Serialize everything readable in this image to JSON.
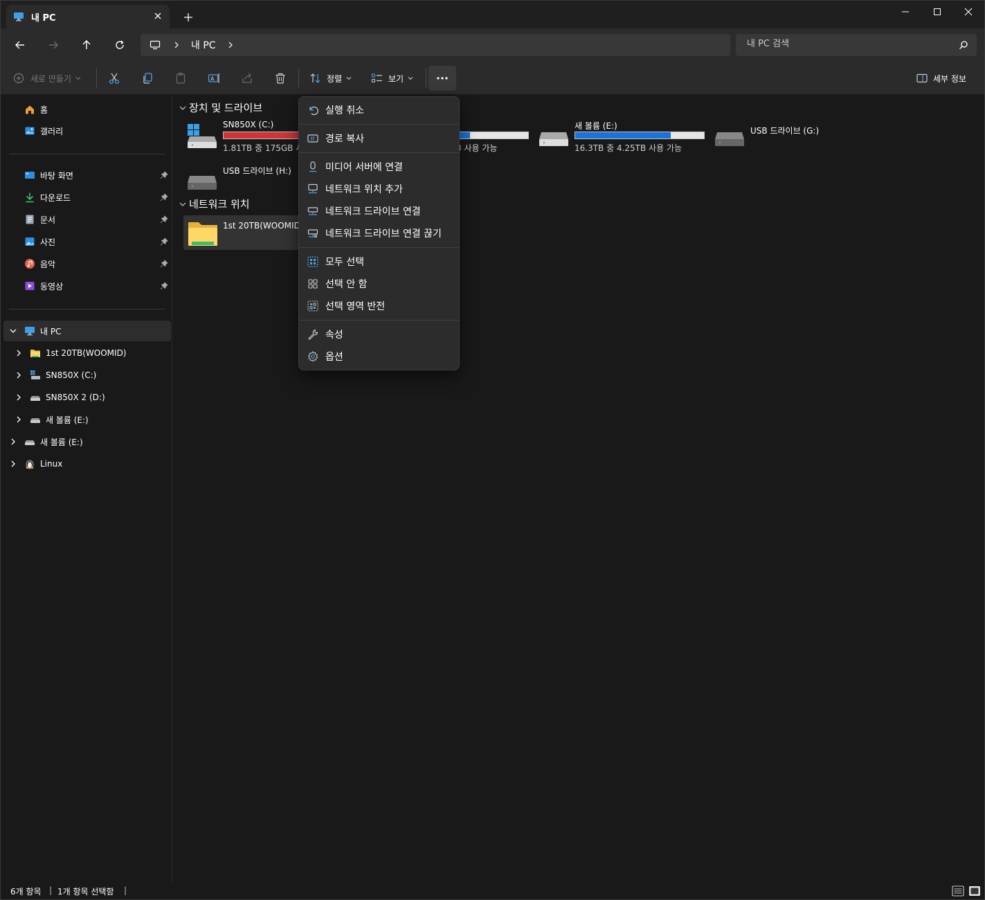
{
  "window": {
    "tab_title": "내 PC",
    "controls": [
      "minimize",
      "maximize",
      "close"
    ]
  },
  "nav": {
    "breadcrumb": [
      "내 PC"
    ],
    "search_placeholder": "내 PC 검색"
  },
  "commandbar": {
    "new_label": "새로 만들기",
    "sort_label": "정렬",
    "view_label": "보기",
    "details_label": "세부 정보"
  },
  "sidebar": {
    "quick": [
      {
        "label": "홈",
        "icon": "home-icon"
      },
      {
        "label": "갤러리",
        "icon": "gallery-icon"
      }
    ],
    "pinned": [
      {
        "label": "바탕 화면",
        "icon": "desktop-icon"
      },
      {
        "label": "다운로드",
        "icon": "download-icon"
      },
      {
        "label": "문서",
        "icon": "documents-icon"
      },
      {
        "label": "사진",
        "icon": "pictures-icon"
      },
      {
        "label": "음악",
        "icon": "music-icon"
      },
      {
        "label": "동영상",
        "icon": "videos-icon"
      }
    ],
    "tree": [
      {
        "label": "내 PC",
        "icon": "pc-icon",
        "expanded": true,
        "selected": true
      },
      {
        "label": "1st 20TB(WOOMID)",
        "icon": "network-folder-icon"
      },
      {
        "label": "SN850X (C:)",
        "icon": "windows-drive-icon"
      },
      {
        "label": "SN850X 2 (D:)",
        "icon": "drive-icon"
      },
      {
        "label": "새 볼륨 (E:)",
        "icon": "drive-icon"
      },
      {
        "label": "새 볼륨 (E:)",
        "icon": "drive-icon"
      },
      {
        "label": "Linux",
        "icon": "linux-icon"
      }
    ]
  },
  "content": {
    "devices_header": "장치 및 드라이브",
    "drives": [
      {
        "name": "SN850X (C:)",
        "free_text": "1.81TB 중 175GB 사",
        "used_fraction": 0.905,
        "bar_color": "#d13438",
        "type": "windows"
      },
      {
        "name": "",
        "free_text": "3 사용 가능",
        "used_fraction": 0.55,
        "bar_color": "#1a73d9",
        "type": "drive"
      },
      {
        "name": "새 볼륨 (E:)",
        "free_text": "16.3TB 중 4.25TB 사용 가능",
        "used_fraction": 0.74,
        "bar_color": "#1a73d9",
        "type": "drive"
      },
      {
        "name": "USB 드라이브 (G:)",
        "free_text": "",
        "used_fraction": null,
        "type": "usb"
      },
      {
        "name": "USB 드라이브 (H:)",
        "free_text": "",
        "used_fraction": null,
        "type": "usb"
      }
    ],
    "network_header": "네트워크 위치",
    "network_items": [
      {
        "name": "1st 20TB(WOOMID)"
      }
    ]
  },
  "context_menu": {
    "items": [
      {
        "label": "실행 취소",
        "icon": "undo-icon"
      },
      {
        "label": "경로 복사",
        "icon": "copy-path-icon"
      },
      {
        "label": "미디어 서버에 연결",
        "icon": "media-server-icon"
      },
      {
        "label": "네트워크 위치 추가",
        "icon": "add-network-location-icon"
      },
      {
        "label": "네트워크 드라이브 연결",
        "icon": "map-network-drive-icon"
      },
      {
        "label": "네트워크 드라이브 연결 끊기",
        "icon": "disconnect-network-drive-icon"
      },
      {
        "label": "모두 선택",
        "icon": "select-all-icon"
      },
      {
        "label": "선택 안 함",
        "icon": "select-none-icon"
      },
      {
        "label": "선택 영역 반전",
        "icon": "invert-selection-icon"
      },
      {
        "label": "속성",
        "icon": "properties-icon"
      },
      {
        "label": "옵션",
        "icon": "options-icon"
      }
    ]
  },
  "status": {
    "item_count": "6개 항목",
    "selected": "1개 항목 선택함"
  },
  "colors": {
    "accent": "#1a73d9",
    "warning_bar": "#d13438",
    "background": "#191919",
    "toolbar": "#2b2b2b"
  }
}
